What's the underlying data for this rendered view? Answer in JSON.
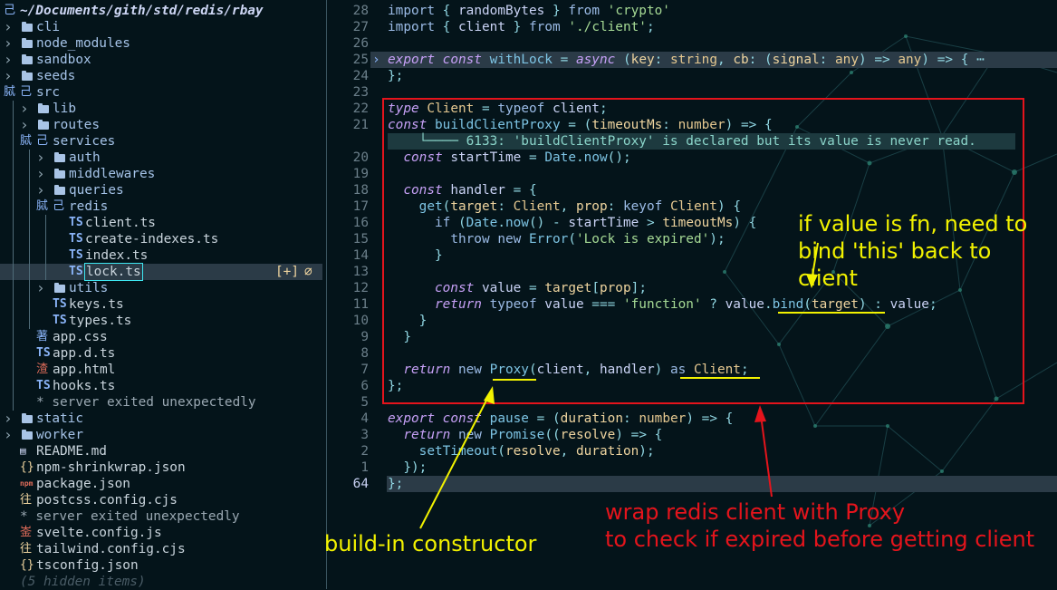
{
  "explorer": {
    "root_path": "~/Documents/gith/std/redis/rbay",
    "items": [
      {
        "label": "cli",
        "kind": "folder",
        "depth": 0,
        "open": false
      },
      {
        "label": "node_modules",
        "kind": "folder",
        "depth": 0,
        "open": false
      },
      {
        "label": "sandbox",
        "kind": "folder",
        "depth": 0,
        "open": false
      },
      {
        "label": "seeds",
        "kind": "folder",
        "depth": 0,
        "open": false
      },
      {
        "label": "src",
        "kind": "folder",
        "depth": 0,
        "open": true
      },
      {
        "label": "lib",
        "kind": "folder",
        "depth": 1,
        "open": false
      },
      {
        "label": "routes",
        "kind": "folder",
        "depth": 1,
        "open": false
      },
      {
        "label": "services",
        "kind": "folder",
        "depth": 1,
        "open": true
      },
      {
        "label": "auth",
        "kind": "folder",
        "depth": 2,
        "open": false
      },
      {
        "label": "middlewares",
        "kind": "folder",
        "depth": 2,
        "open": false
      },
      {
        "label": "queries",
        "kind": "folder",
        "depth": 2,
        "open": false
      },
      {
        "label": "redis",
        "kind": "folder",
        "depth": 2,
        "open": true
      },
      {
        "label": "client.ts",
        "kind": "ts",
        "depth": 3
      },
      {
        "label": "create-indexes.ts",
        "kind": "ts",
        "depth": 3
      },
      {
        "label": "index.ts",
        "kind": "ts",
        "depth": 3
      },
      {
        "label": "lock.ts",
        "kind": "ts",
        "depth": 3,
        "selected": true,
        "badge": "[+]"
      },
      {
        "label": "utils",
        "kind": "folder",
        "depth": 2,
        "open": false
      },
      {
        "label": "keys.ts",
        "kind": "ts",
        "depth": 2
      },
      {
        "label": "types.ts",
        "kind": "ts",
        "depth": 2
      },
      {
        "label": "app.css",
        "kind": "css",
        "depth": 1
      },
      {
        "label": "app.d.ts",
        "kind": "ts",
        "depth": 1
      },
      {
        "label": "app.html",
        "kind": "html",
        "depth": 1
      },
      {
        "label": "hooks.ts",
        "kind": "ts",
        "depth": 1
      },
      {
        "label": "* server exited unexpectedly",
        "kind": "msg",
        "depth": 1
      },
      {
        "label": "static",
        "kind": "folder",
        "depth": 0,
        "open": false
      },
      {
        "label": "worker",
        "kind": "folder",
        "depth": 0,
        "open": false
      },
      {
        "label": "README.md",
        "kind": "md",
        "depth": 0
      },
      {
        "label": "npm-shrinkwrap.json",
        "kind": "json",
        "depth": 0
      },
      {
        "label": "package.json",
        "kind": "npm",
        "depth": 0
      },
      {
        "label": "postcss.config.cjs",
        "kind": "cfg",
        "depth": 0
      },
      {
        "label": "* server exited unexpectedly",
        "kind": "msg",
        "depth": 0
      },
      {
        "label": "svelte.config.js",
        "kind": "svelte",
        "depth": 0
      },
      {
        "label": "tailwind.config.cjs",
        "kind": "cfg",
        "depth": 0
      },
      {
        "label": "tsconfig.json",
        "kind": "json",
        "depth": 0
      },
      {
        "label": "(5 hidden items)",
        "kind": "hidden",
        "depth": 0
      }
    ]
  },
  "editor": {
    "lines": [
      {
        "n": "28",
        "code": "import { randomBytes } from 'crypto'"
      },
      {
        "n": "27",
        "code": "import { client } from './client';"
      },
      {
        "n": "26",
        "code": ""
      },
      {
        "n": "25",
        "code": "export const withLock = async (key: string, cb: (signal: any) => any) => { ⋯",
        "fold": true
      },
      {
        "n": "24",
        "code": "};"
      },
      {
        "n": "23",
        "code": ""
      },
      {
        "n": "22",
        "code": "type Client = typeof client;"
      },
      {
        "n": "21",
        "code": "const buildClientProxy = (timeoutMs: number) => {"
      },
      {
        "n": "",
        "code": "    └──── 6133: 'buildClientProxy' is declared but its value is never read.",
        "diag": true
      },
      {
        "n": "20",
        "code": "  const startTime = Date.now();"
      },
      {
        "n": "19",
        "code": ""
      },
      {
        "n": "18",
        "code": "  const handler = {"
      },
      {
        "n": "17",
        "code": "    get(target: Client, prop: keyof Client) {"
      },
      {
        "n": "16",
        "code": "      if (Date.now() - startTime > timeoutMs) {"
      },
      {
        "n": "15",
        "code": "        throw new Error('Lock is expired');"
      },
      {
        "n": "14",
        "code": "      }"
      },
      {
        "n": "13",
        "code": ""
      },
      {
        "n": "12",
        "code": "      const value = target[prop];"
      },
      {
        "n": "11",
        "code": "      return typeof value === 'function' ? value.bind(target) : value;"
      },
      {
        "n": "10",
        "code": "    }"
      },
      {
        "n": "9",
        "code": "  }"
      },
      {
        "n": "8",
        "code": ""
      },
      {
        "n": "7",
        "code": "  return new Proxy(client, handler) as Client;"
      },
      {
        "n": "6",
        "code": "};"
      },
      {
        "n": "5",
        "code": ""
      },
      {
        "n": "4",
        "code": "export const pause = (duration: number) => {"
      },
      {
        "n": "3",
        "code": "  return new Promise((resolve) => {"
      },
      {
        "n": "2",
        "code": "    setTimeout(resolve, duration);"
      },
      {
        "n": "1",
        "code": "  });"
      },
      {
        "n": "64",
        "code": "};",
        "current": true
      }
    ]
  },
  "annotations": {
    "bind_note_1": "if value is fn, need to",
    "bind_note_2": "bind 'this' back to client",
    "constructor_note": "build-in constructor",
    "proxy_note_1": "wrap redis client with Proxy",
    "proxy_note_2": "to check if expired before getting client"
  },
  "colors": {
    "background": "#04141a",
    "annotation_yellow": "#f2f200",
    "annotation_red": "#e4141c",
    "selection": "#2b3b47"
  }
}
